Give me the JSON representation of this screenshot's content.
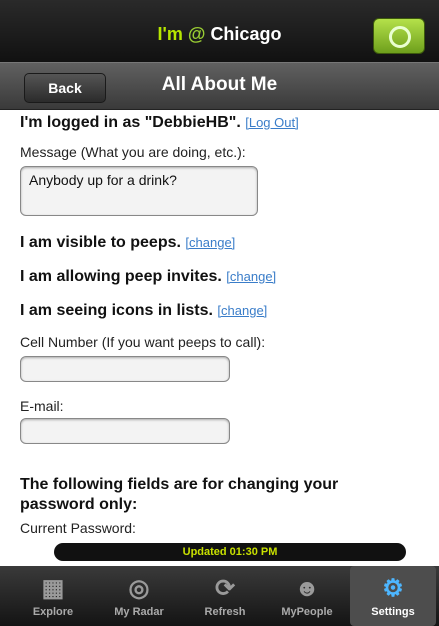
{
  "header": {
    "title_prefix": "I'm",
    "title_at": "@",
    "title_city": "Chicago",
    "button_icon": "location-icon"
  },
  "nav": {
    "back_label": "Back",
    "title": "All About Me"
  },
  "content": {
    "logged_in_text": "I'm logged in as \"DebbieHB\".",
    "logout_link": "[Log Out]",
    "message_label": "Message (What you are doing, etc.):",
    "message_value": "Anybody up for a drink?",
    "visible_text": "I am visible to peeps.",
    "visible_change": "[change]",
    "invites_text": "I am allowing peep invites.",
    "invites_change": "[change]",
    "icons_text": "I am seeing icons in lists.",
    "icons_change": "[change]",
    "cell_label": "Cell Number (If you want peeps to call):",
    "cell_value": "",
    "email_label": "E-mail:",
    "email_value": "",
    "password_heading_1": "The following fields are for changing your",
    "password_heading_2": "password only:",
    "current_password_label": "Current Password:"
  },
  "status": {
    "updated_text": "Updated 01:30 PM"
  },
  "tabs": [
    {
      "label": "Explore",
      "icon": "grid-icon",
      "active": false
    },
    {
      "label": "My Radar",
      "icon": "radar-icon",
      "active": false
    },
    {
      "label": "Refresh",
      "icon": "refresh-icon",
      "active": false
    },
    {
      "label": "MyPeople",
      "icon": "people-icon",
      "active": false
    },
    {
      "label": "Settings",
      "icon": "gear-icon",
      "active": true
    }
  ]
}
